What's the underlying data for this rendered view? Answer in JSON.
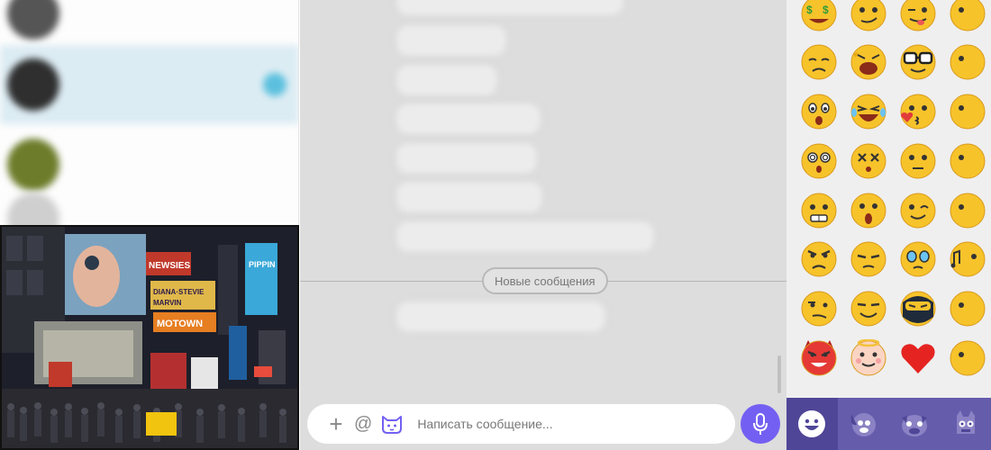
{
  "chats": [
    {
      "name": "",
      "preview": "",
      "color": "#4a4a4a",
      "active": false
    },
    {
      "name": "",
      "preview": "",
      "color": "#303030",
      "active": true
    },
    {
      "name": "",
      "preview": "",
      "color": "#6b7a2c",
      "active": false
    },
    {
      "name": "",
      "preview": "",
      "color": "#cfcfcf",
      "active": false
    }
  ],
  "messages": [
    "",
    "",
    "",
    "",
    "",
    "",
    "",
    "",
    ""
  ],
  "divider_label": "Новые сообщения",
  "composer": {
    "placeholder": "Написать сообщение..."
  },
  "emojis": [
    "money-face",
    "smirk-face",
    "wink-tongue-face",
    "half-visible-face",
    "sad-face",
    "crazy-laugh-face",
    "nerd-glasses-face",
    "half-visible-face",
    "surprised-face",
    "laughing-tears-face",
    "kiss-heart-face",
    "half-visible-face",
    "dizzy-face",
    "dead-eyes-face",
    "neutral-face",
    "half-visible-face",
    "grimace-face",
    "shocked-face",
    "wink-face",
    "half-visible-face",
    "angry-face",
    "annoyed-face",
    "teary-face",
    "music-face",
    "skeptical-face",
    "sly-face",
    "ninja-face",
    "half-visible-face",
    "devil-face",
    "angel-face",
    "red-heart",
    "half-visible-face"
  ],
  "tabs": [
    "smiley-tab",
    "dog-tab",
    "pug-tab",
    "monster-tab"
  ],
  "colors": {
    "accent": "#7360f2",
    "tab_bar": "#665cac",
    "active_chat": "#dcecf3",
    "emoji_yellow": "#f7c32b"
  }
}
